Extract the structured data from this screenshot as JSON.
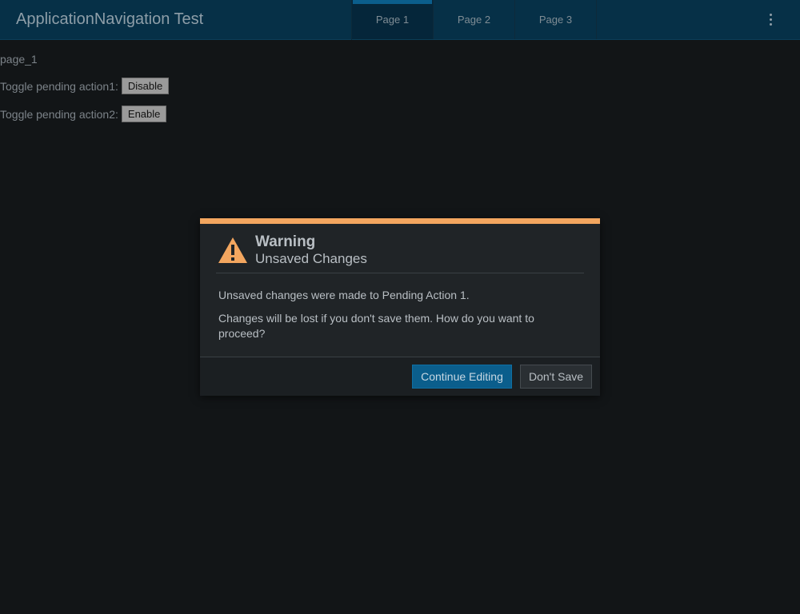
{
  "header": {
    "title": "ApplicationNavigation Test",
    "tabs": [
      {
        "label": "Page 1",
        "active": true
      },
      {
        "label": "Page 2",
        "active": false
      },
      {
        "label": "Page 3",
        "active": false
      }
    ],
    "menu_icon": "kebab-menu-icon"
  },
  "page": {
    "id_text": "page_1",
    "rows": [
      {
        "label": "Toggle pending action1:",
        "button": "Disable"
      },
      {
        "label": "Toggle pending action2:",
        "button": "Enable"
      }
    ]
  },
  "dialog": {
    "icon": "warning-icon",
    "title": "Warning",
    "subtitle": "Unsaved Changes",
    "message1": "Unsaved changes were made to Pending Action 1.",
    "message2": "Changes will be lost if you don't save them. How do you want to proceed?",
    "primary_button": "Continue Editing",
    "secondary_button": "Don't Save"
  },
  "colors": {
    "accent": "#f3a65f",
    "primary": "#0b5e8c",
    "header_bg": "#063047",
    "background": "#121517"
  }
}
